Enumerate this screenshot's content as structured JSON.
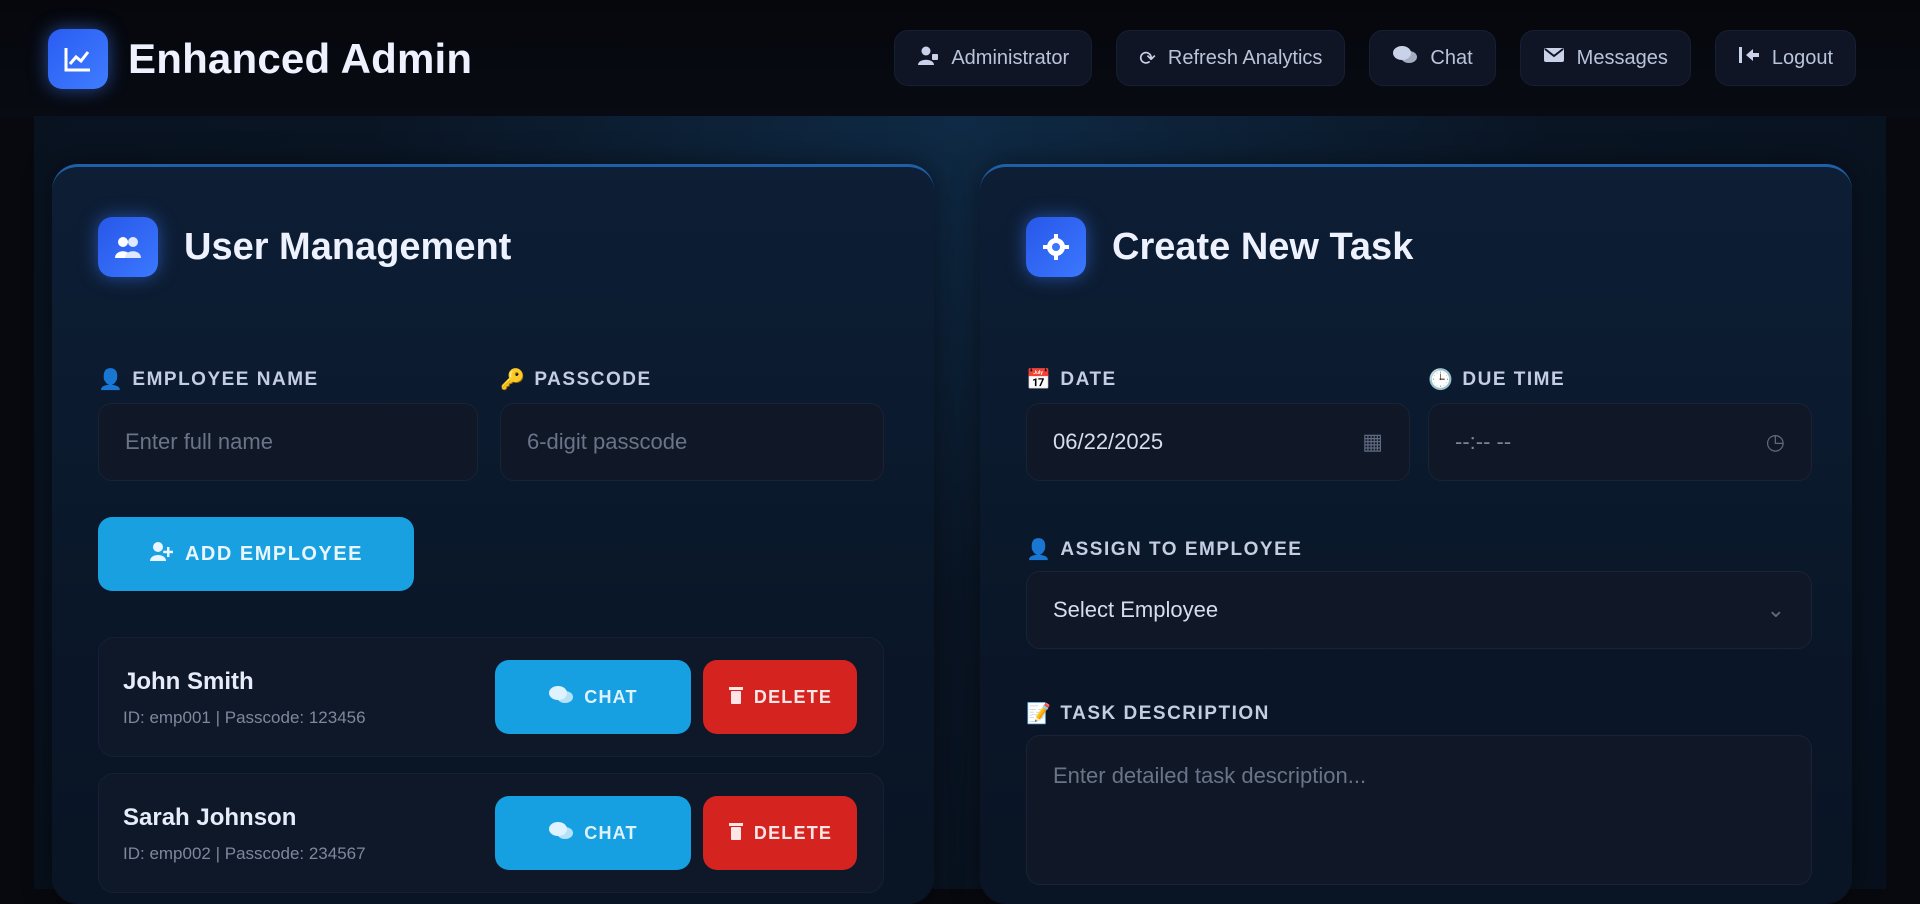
{
  "app": {
    "title": "Enhanced Admin"
  },
  "nav": [
    {
      "label": "Administrator",
      "icon": "admin-icon"
    },
    {
      "label": "Refresh Analytics",
      "icon": "refresh-icon"
    },
    {
      "label": "Chat",
      "icon": "chat-icon"
    },
    {
      "label": "Messages",
      "icon": "mail-icon"
    },
    {
      "label": "Logout",
      "icon": "logout-icon"
    }
  ],
  "user_management": {
    "title": "User Management",
    "name_label": "Employee Name",
    "name_placeholder": "Enter full name",
    "passcode_label": "Passcode",
    "passcode_placeholder": "6-digit passcode",
    "add_button": "Add Employee",
    "employees": [
      {
        "name": "John Smith",
        "meta": "ID: emp001 | Passcode: 123456",
        "chat": "Chat",
        "delete": "Delete"
      },
      {
        "name": "Sarah Johnson",
        "meta": "ID: emp002 | Passcode: 234567",
        "chat": "Chat",
        "delete": "Delete"
      }
    ]
  },
  "create_task": {
    "title": "Create New Task",
    "date_label": "Date",
    "date_value": "06/22/2025",
    "time_label": "Due Time",
    "time_value": "--:-- --",
    "assign_label": "Assign to Employee",
    "assign_value": "Select Employee",
    "desc_label": "Task Description",
    "desc_placeholder": "Enter detailed task description..."
  },
  "colors": {
    "accent": "#19a0e0",
    "danger": "#d52320",
    "brand": "#3f7dff",
    "background": "#07090f"
  }
}
